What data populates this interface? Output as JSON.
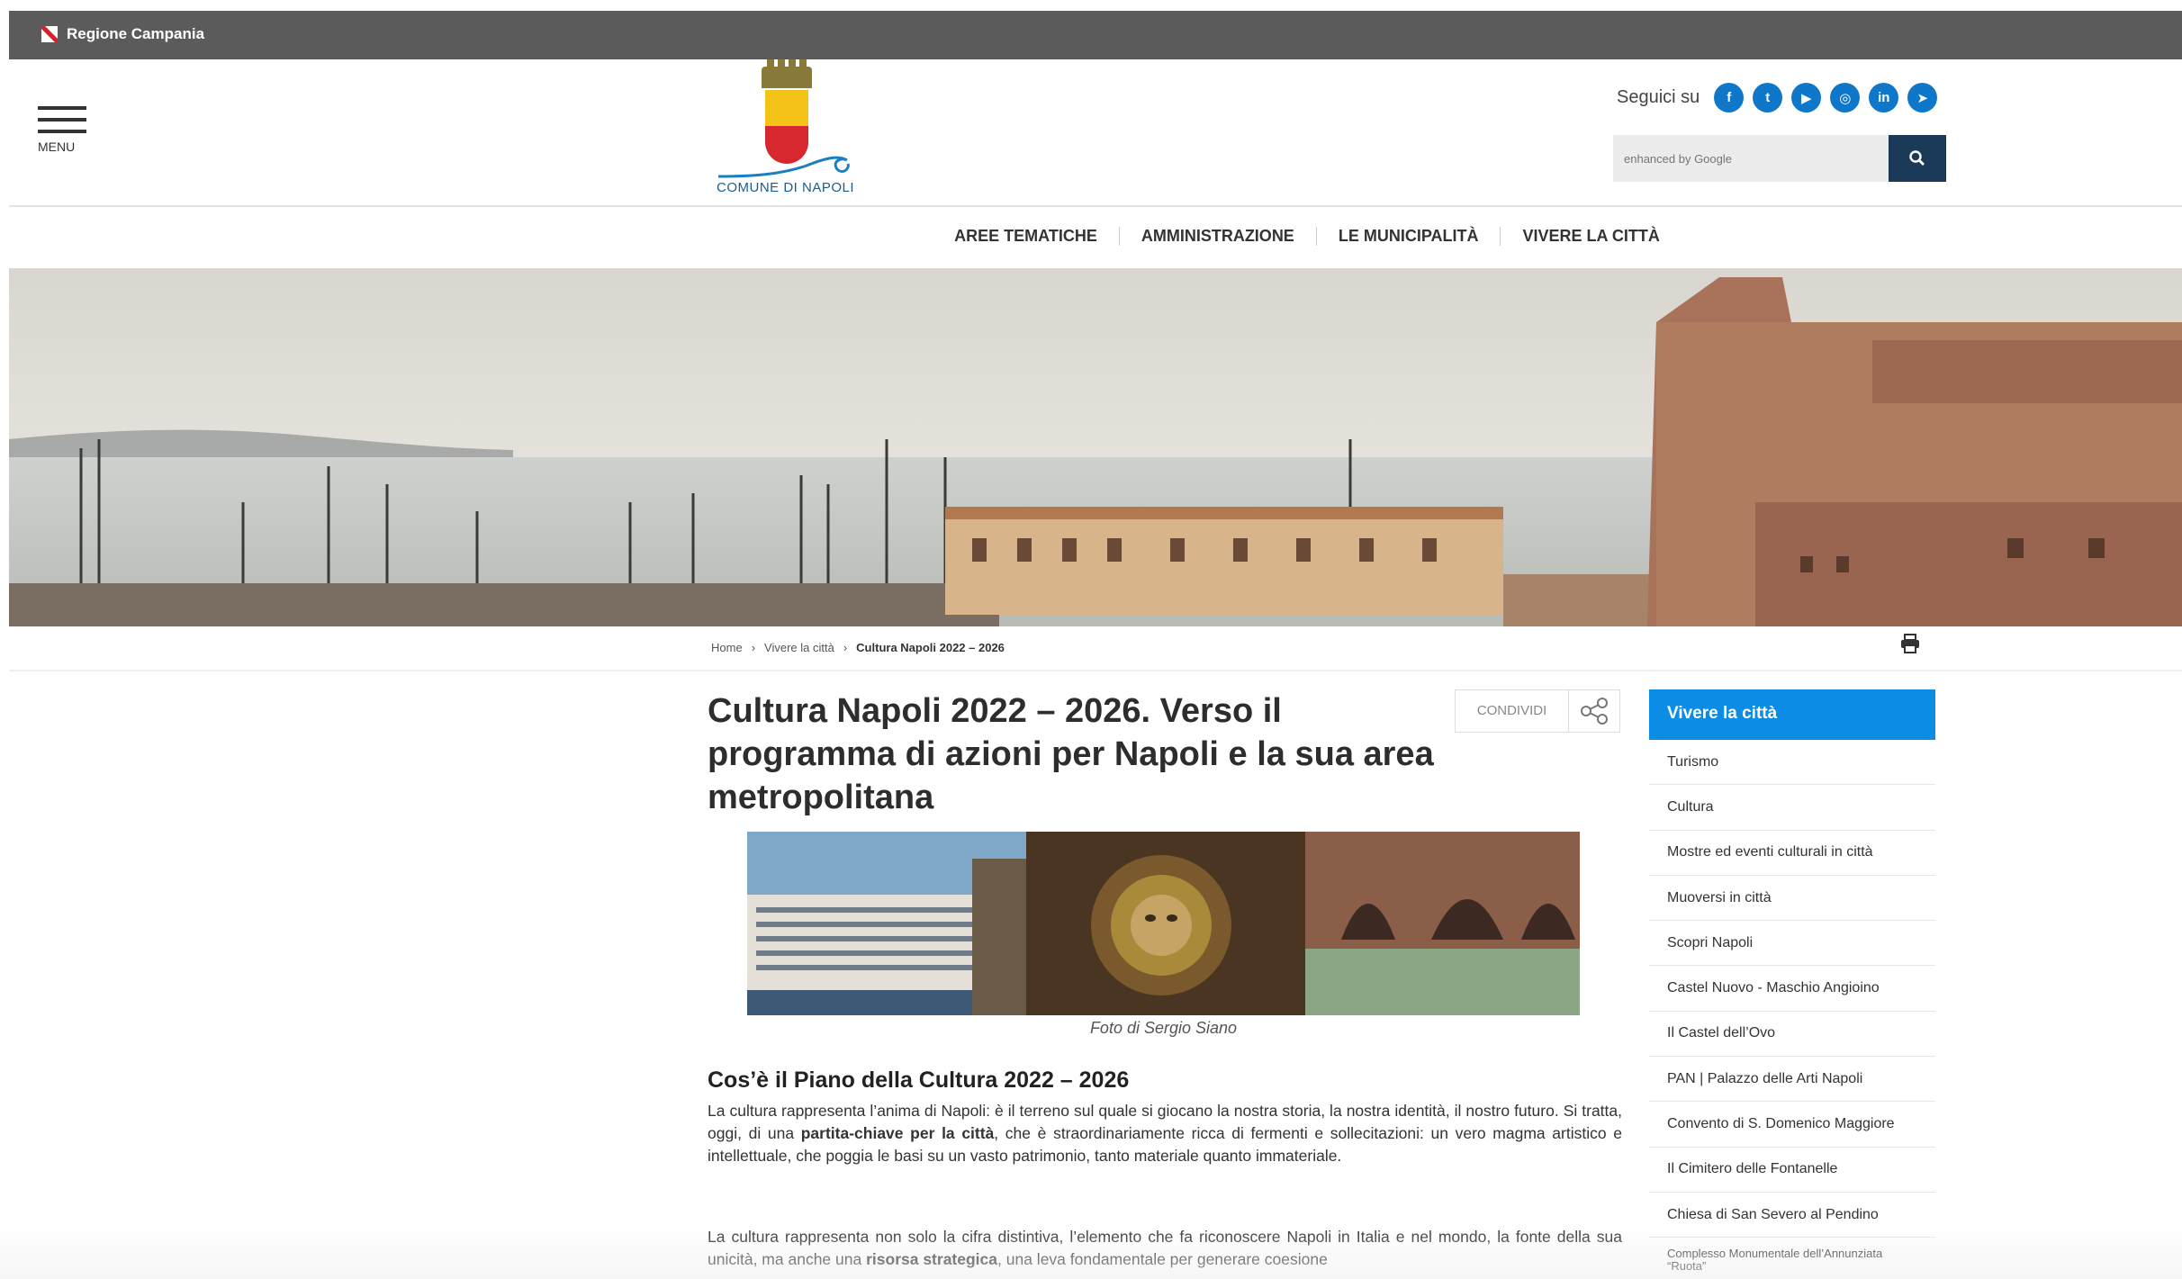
{
  "topbar": {
    "region": "Regione Campania"
  },
  "header": {
    "menu_label": "MENU",
    "logo_name": "COMUNE DI NAPOLI",
    "social_label": "Seguici su",
    "social_icons": [
      "facebook-icon",
      "twitter-icon",
      "youtube-icon",
      "instagram-icon",
      "linkedin-icon",
      "telegram-icon"
    ],
    "search_placeholder": "enhanced by Google"
  },
  "nav": [
    "AREE TEMATICHE",
    "AMMINISTRAZIONE",
    "LE MUNICIPALITÀ",
    "VIVERE LA CITTÀ"
  ],
  "breadcrumb": [
    "Home",
    "Vivere la città",
    "Cultura Napoli 2022 – 2026"
  ],
  "article": {
    "title": "Cultura Napoli 2022 – 2026. Verso il programma di azioni per Napoli e la sua area metropolitana",
    "share_label": "CONDIVIDI",
    "photo_caption": "Foto di Sergio Siano",
    "section_title": "Cos’è il Piano della Cultura 2022 – 2026",
    "p1_a": "La cultura rappresenta l’anima di Napoli: è il terreno sul quale si giocano la nostra storia, la nostra identità, il nostro futuro. Si tratta, oggi, di una ",
    "p1_b": "partita-chiave per la città",
    "p1_c": ", che è straordinariamente ricca di fermenti e sollecitazioni: un vero magma artistico e intellettuale, che poggia le basi su un vasto patrimonio, tanto materiale quanto immateriale.",
    "p2_a": "La cultura rappresenta non solo la cifra distintiva, l’elemento che fa riconoscere Napoli in Italia e nel mondo, la fonte della sua unicità, ma anche una ",
    "p2_b": "risorsa strategica",
    "p2_c": ", una leva fondamentale per generare coesione"
  },
  "sidebar": {
    "heading": "Vivere la città",
    "items": [
      "Turismo",
      "Cultura",
      "Mostre ed eventi culturali in città",
      "Muoversi in città",
      "Scopri Napoli",
      "Castel Nuovo - Maschio Angioino",
      "Il Castel dell’Ovo",
      "PAN | Palazzo delle Arti Napoli",
      "Convento di S. Domenico Maggiore",
      "Il Cimitero delle Fontanelle",
      "Chiesa di San Severo al Pendino",
      "Complesso Monumentale dell’Annunziata “Ruota”"
    ]
  }
}
